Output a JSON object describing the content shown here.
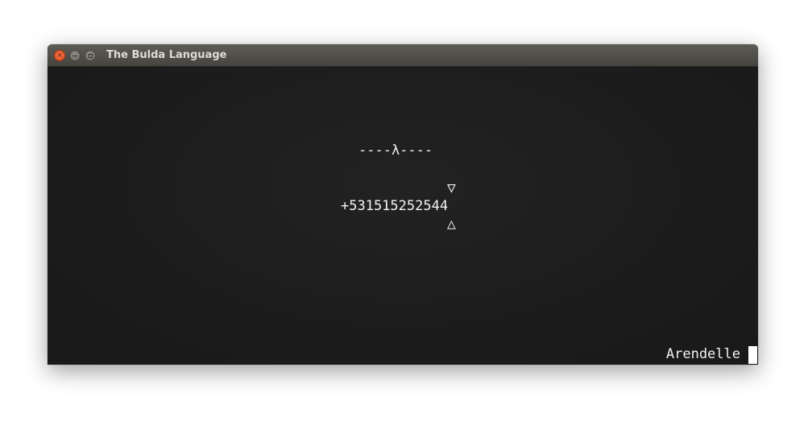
{
  "window": {
    "title": "The Bulda Language"
  },
  "titlebar_buttons": {
    "close_glyph": "×"
  },
  "terminal": {
    "lambda_line": "----λ----",
    "arrow_down": "▽",
    "number_line": "+531515252544",
    "arrow_up": "△",
    "prompt_text": "Arendelle"
  },
  "colors": {
    "close_button": "#df4b16",
    "titlebar": "#4f4e49",
    "terminal_background": "#1c1c1c",
    "text": "#f2f2f2"
  }
}
